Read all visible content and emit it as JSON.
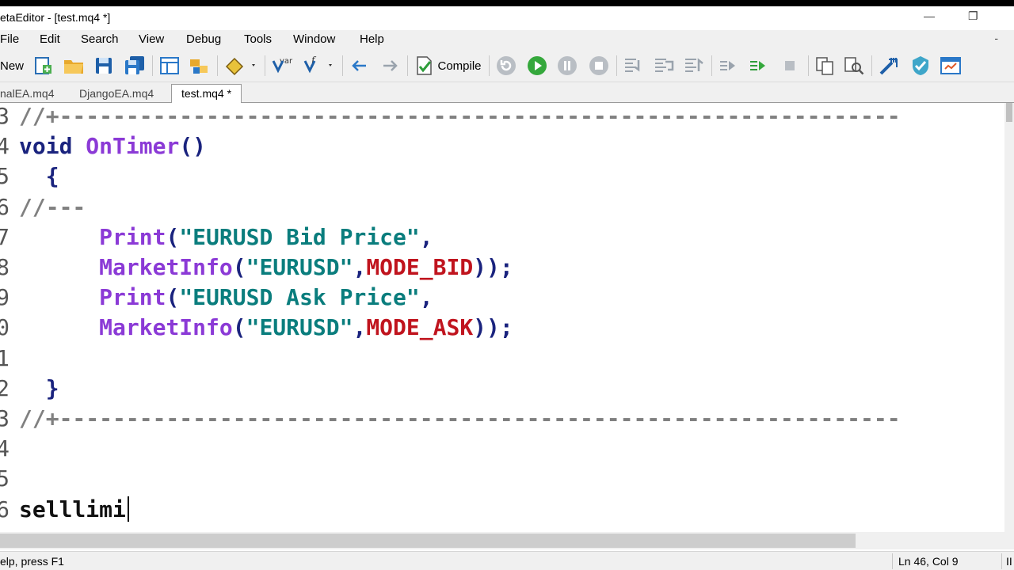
{
  "window": {
    "title": "etaEditor - [test.mq4 *]"
  },
  "menu": [
    "File",
    "Edit",
    "Search",
    "View",
    "Debug",
    "Tools",
    "Window",
    "Help"
  ],
  "toolbar": {
    "new_label": "New",
    "compile_label": "Compile",
    "var_label": "var",
    "icons": [
      "new-project-icon",
      "open-folder-icon",
      "save-icon",
      "save-all-icon",
      "navigator-panel-icon",
      "toolbox-panel-icon",
      "styler-icon",
      "insert-variable-icon",
      "insert-function-icon",
      "back-arrow-icon",
      "forward-arrow-icon",
      "compile-icon",
      "restart-icon",
      "start-debug-icon",
      "pause-icon",
      "stop-icon",
      "step-into-icon",
      "step-over-icon",
      "step-out-icon",
      "run-to-cursor-icon",
      "continue-icon",
      "stop-debug-icon",
      "copy-icon",
      "find-icon",
      "wand-icon",
      "check-icon",
      "terminal-icon"
    ]
  },
  "tabs": [
    {
      "label": "nalEA.mq4",
      "active": false
    },
    {
      "label": "DjangoEA.mq4",
      "active": false
    },
    {
      "label": "test.mq4 *",
      "active": true
    }
  ],
  "editor": {
    "lines": [
      {
        "num": "3",
        "tokens": [
          {
            "t": "//+---------------------------------------------------------------",
            "c": "comment"
          }
        ]
      },
      {
        "num": "4",
        "tokens": [
          {
            "t": "void",
            "c": "kw"
          },
          {
            "t": " ",
            "c": "punct"
          },
          {
            "t": "OnTimer",
            "c": "fn"
          },
          {
            "t": "()",
            "c": "punct"
          }
        ]
      },
      {
        "num": "5",
        "tokens": [
          {
            "t": "  {",
            "c": "punct"
          }
        ]
      },
      {
        "num": "6",
        "tokens": [
          {
            "t": "//---",
            "c": "comment"
          }
        ]
      },
      {
        "num": "7",
        "tokens": [
          {
            "t": "      ",
            "c": "punct"
          },
          {
            "t": "Print",
            "c": "fn"
          },
          {
            "t": "(",
            "c": "punct"
          },
          {
            "t": "\"EURUSD Bid Price\"",
            "c": "str"
          },
          {
            "t": ",",
            "c": "punct"
          }
        ]
      },
      {
        "num": "8",
        "tokens": [
          {
            "t": "      ",
            "c": "punct"
          },
          {
            "t": "MarketInfo",
            "c": "fn"
          },
          {
            "t": "(",
            "c": "punct"
          },
          {
            "t": "\"EURUSD\"",
            "c": "str"
          },
          {
            "t": ",",
            "c": "punct"
          },
          {
            "t": "MODE_BID",
            "c": "const"
          },
          {
            "t": "));",
            "c": "punct"
          }
        ]
      },
      {
        "num": "9",
        "tokens": [
          {
            "t": "      ",
            "c": "punct"
          },
          {
            "t": "Print",
            "c": "fn"
          },
          {
            "t": "(",
            "c": "punct"
          },
          {
            "t": "\"EURUSD Ask Price\"",
            "c": "str"
          },
          {
            "t": ",",
            "c": "punct"
          }
        ]
      },
      {
        "num": "0",
        "tokens": [
          {
            "t": "      ",
            "c": "punct"
          },
          {
            "t": "MarketInfo",
            "c": "fn"
          },
          {
            "t": "(",
            "c": "punct"
          },
          {
            "t": "\"EURUSD\"",
            "c": "str"
          },
          {
            "t": ",",
            "c": "punct"
          },
          {
            "t": "MODE_ASK",
            "c": "const"
          },
          {
            "t": "));",
            "c": "punct"
          }
        ]
      },
      {
        "num": "1",
        "tokens": []
      },
      {
        "num": "2",
        "tokens": [
          {
            "t": "  }",
            "c": "punct"
          }
        ]
      },
      {
        "num": "3",
        "tokens": [
          {
            "t": "//+---------------------------------------------------------------",
            "c": "comment"
          }
        ]
      },
      {
        "num": "4",
        "tokens": []
      },
      {
        "num": "5",
        "tokens": []
      },
      {
        "num": "6",
        "tokens": [
          {
            "t": "selllimi",
            "c": "typed"
          }
        ],
        "caret": true
      }
    ]
  },
  "status": {
    "help": "elp, press F1",
    "position": "Ln 46, Col 9",
    "extra": "II"
  },
  "colors": {
    "keyword": "#1a237e",
    "function": "#8b3ad6",
    "string": "#0a7d7d",
    "constant": "#c0141e",
    "comment": "#808080"
  }
}
